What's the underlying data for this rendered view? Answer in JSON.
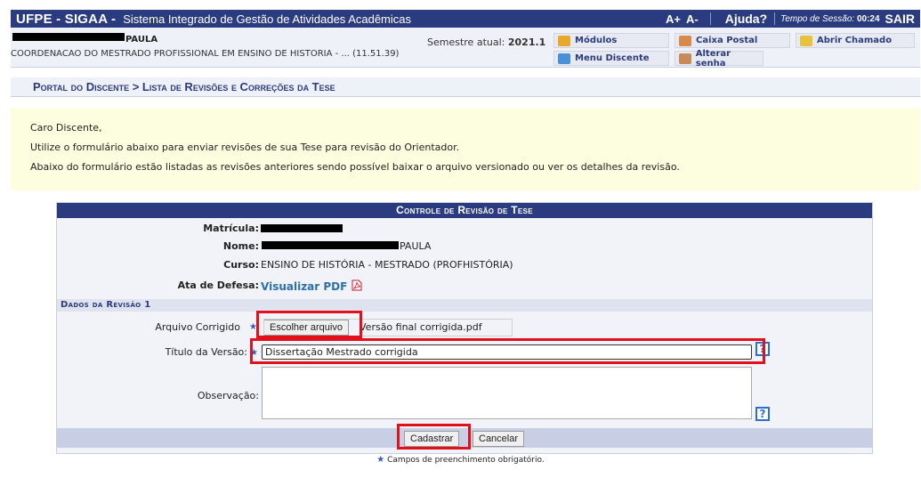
{
  "header": {
    "brand": "UFPE - SIGAA -",
    "system_name": "Sistema Integrado de Gestão de Atividades Acadêmicas",
    "font_increase": "A+",
    "font_decrease": "A-",
    "help": "Ajuda?",
    "session_label": "Tempo de Sessão:",
    "session_time": "00:24",
    "logout": "SAIR"
  },
  "user": {
    "name_visible": "PAULA",
    "unit": "COORDENACAO DO MESTRADO PROFISSIONAL EM ENSINO DE HISTORIA - ... (11.51.39)",
    "semester_label": "Semestre atual:",
    "semester_value": "2021.1"
  },
  "quick_links": {
    "modulos": "Módulos",
    "caixa_postal": "Caixa Postal",
    "abrir_chamado": "Abrir Chamado",
    "menu_discente": "Menu Discente",
    "alterar_senha": "Alterar senha"
  },
  "breadcrumb": "Portal do Discente > Lista de Revisões e Correções da Tese",
  "intro": {
    "greeting": "Caro Discente,",
    "line1": "Utilize o formulário abaixo para enviar revisões de sua Tese para revisão do Orientador.",
    "line2": "Abaixo do formulário estão listadas as revisões anteriores sendo possível baixar o arquivo versionado ou ver os detalhes da revisão."
  },
  "form": {
    "title": "Controle de Revisão de Tese",
    "matricula_label": "Matrícula:",
    "nome_label": "Nome:",
    "nome_value": "PAULA",
    "curso_label": "Curso:",
    "curso_value": "ENSINO DE HISTÓRIA - MESTRADO (PROFHISTÓRIA)",
    "ata_label": "Ata de Defesa:",
    "ata_link": "Visualizar PDF",
    "section_title": "Dados da Revisão 1",
    "arquivo_label": "Arquivo Corrigido",
    "arquivo_button": "Escolher arquivo",
    "arquivo_value": "Versão final corrigida.pdf",
    "titulo_label": "Título da Versão:",
    "titulo_value": "Dissertação Mestrado corrigida",
    "observacao_label": "Observação:",
    "submit": "Cadastrar",
    "cancel": "Cancelar",
    "required_star": "★",
    "help_glyph": "?",
    "required_note": "Campos de preenchimento obrigatório."
  },
  "colors": {
    "header": "#2b3b80",
    "highlight": "#e0111b",
    "intro_bg": "#fdfde0"
  }
}
